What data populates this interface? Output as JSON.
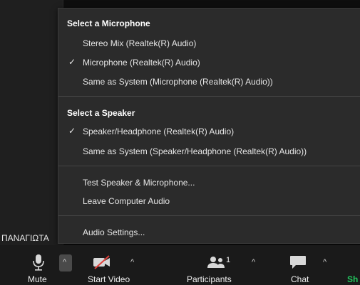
{
  "participant": {
    "name": "ΠΑΝΑΓΙΩΤΑ"
  },
  "menu": {
    "microphone_heading": "Select a Microphone",
    "microphone_options": [
      {
        "label": "Stereo Mix (Realtek(R) Audio)",
        "checked": false
      },
      {
        "label": "Microphone (Realtek(R) Audio)",
        "checked": true
      },
      {
        "label": "Same as System (Microphone (Realtek(R) Audio))",
        "checked": false
      }
    ],
    "speaker_heading": "Select a Speaker",
    "speaker_options": [
      {
        "label": "Speaker/Headphone (Realtek(R) Audio)",
        "checked": true
      },
      {
        "label": "Same as System (Speaker/Headphone (Realtek(R) Audio))",
        "checked": false
      }
    ],
    "test_label": "Test Speaker & Microphone...",
    "leave_label": "Leave Computer Audio",
    "settings_label": "Audio Settings...",
    "check_glyph": "✓"
  },
  "toolbar": {
    "mute_label": "Mute",
    "start_video_label": "Start Video",
    "participants_label": "Participants",
    "participants_count": "1",
    "chat_label": "Chat",
    "share_label": "Sh",
    "caret_glyph": "^"
  },
  "colors": {
    "menu_bg": "#2b2b2b",
    "toolbar_bg": "#1a1a1a",
    "share_green": "#22c55e",
    "video_off_red": "#e0403a"
  }
}
